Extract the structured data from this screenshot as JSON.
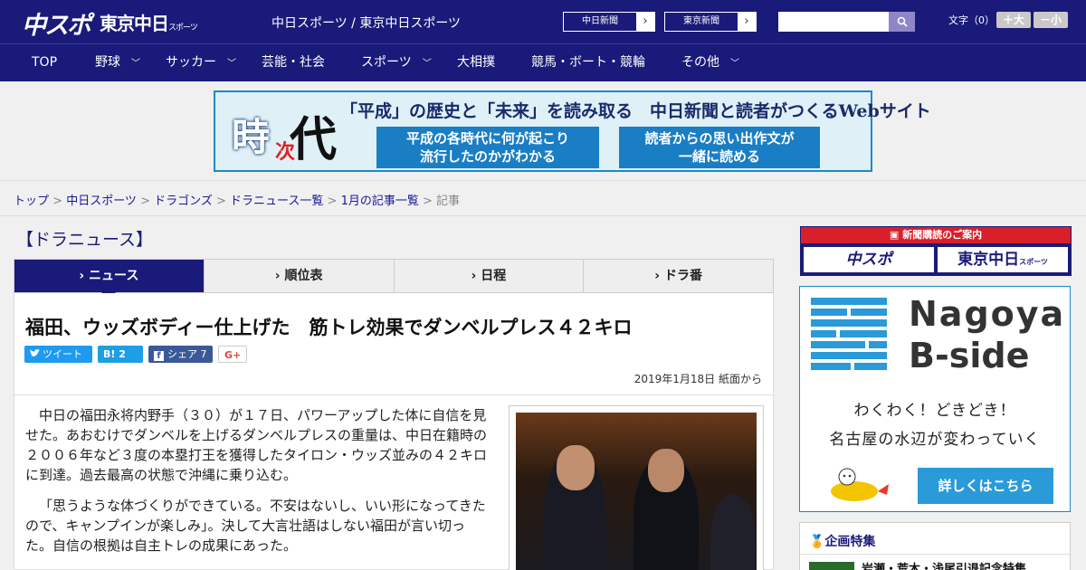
{
  "header": {
    "logo_chuspo": "中スポ",
    "logo_tokyo": "東京中日",
    "logo_tokyo_small": "スポーツ",
    "site_title": "中日スポーツ / 東京中日スポーツ",
    "paper_links": [
      "中日新聞",
      "東京新聞"
    ],
    "search_placeholder": "",
    "font_size_label": "文字（0）",
    "font_larger": "＋大",
    "font_smaller": "－小"
  },
  "nav": {
    "items": [
      {
        "label": "TOP",
        "has_menu": false
      },
      {
        "label": "野球",
        "has_menu": true
      },
      {
        "label": "サッカー",
        "has_menu": true
      },
      {
        "label": "芸能・社会",
        "has_menu": false
      },
      {
        "label": "スポーツ",
        "has_menu": true
      },
      {
        "label": "大相撲",
        "has_menu": false
      },
      {
        "label": "競馬・ボート・競輪",
        "has_menu": false
      },
      {
        "label": "その他",
        "has_menu": true
      }
    ]
  },
  "banner": {
    "kanji_toki": "時",
    "kanji_ji": "次",
    "kanji_dai": "代",
    "headline": "「平成」の歴史と「未来」を読み取る　中日新聞と読者がつくるWebサイト",
    "box1_line1": "平成の各時代に何が起こり",
    "box1_line2": "流行したのかがわかる",
    "box2_line1": "読者からの思い出作文が",
    "box2_line2": "一緒に読める"
  },
  "breadcrumb": {
    "links": [
      "トップ",
      "中日スポーツ",
      "ドラゴンズ",
      "ドラニュース一覧",
      "1月の記事一覧"
    ],
    "current": "記事",
    "separator": " > "
  },
  "section": {
    "title": "【ドラニュース】"
  },
  "tabs": [
    "ニュース",
    "順位表",
    "日程",
    "ドラ番"
  ],
  "article": {
    "title": "福田、ウッズボディー仕上げた　筋トレ効果でダンベルプレス４２キロ",
    "share_tweet": "ツイート",
    "share_hatena": "B! 2",
    "share_facebook": "シェア 7",
    "share_gplus": "G+",
    "date": "2019年1月18日 紙面から",
    "paragraphs": [
      "中日の福田永将内野手（３０）が１７日、パワーアップした体に自信を見せた。あおむけでダンベルを上げるダンベルプレスの重量は、中日在籍時の２００６年など３度の本塁打王を獲得したタイロン・ウッズ並みの４２キロに到達。過去最高の状態で沖縄に乗り込む。",
      "「思うような体づくりができている。不安はないし、いい形になってきたので、キャンプインが楽しみ」。決して大言壮語はしない福田が言い切った。自信の根拠は自主トレの成果にあった。"
    ]
  },
  "sidebar": {
    "subscribe_head": "新聞購読のご案内",
    "subscribe_logo1": "中スポ",
    "subscribe_logo2": "東京中日",
    "subscribe_logo2_small": "スポーツ",
    "nagoya_word1": "Nagoya",
    "nagoya_word2": "B-side",
    "nagoya_sub1": "わくわく！どきどき！",
    "nagoya_sub2": "名古屋の水辺が変わっていく",
    "nagoya_button": "詳しくはこちら",
    "kikaku_head": "企画特集",
    "kikaku_item": "岩瀬・荒木・浅尾引退記念特集"
  },
  "colors": {
    "header_bg": "#1a1a7a",
    "accent_blue": "#2a9ad8",
    "subscribe_red": "#d8202a",
    "twitter": "#1d9bf0",
    "hatena": "#1e9ee6",
    "facebook": "#3b5998"
  }
}
